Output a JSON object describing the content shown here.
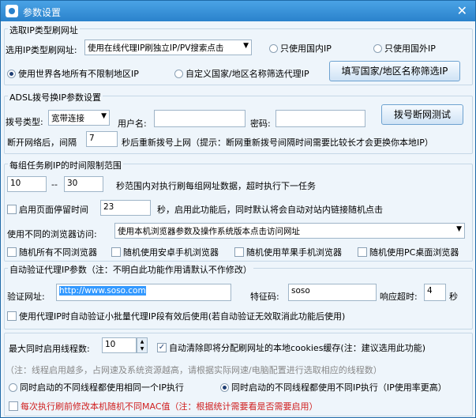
{
  "window": {
    "title": "参数设置",
    "close_glyph": "✕"
  },
  "ip_type": {
    "group_title": "选取IP类型刷网址",
    "select_label": "选用IP类型刷网址:",
    "select_value": "使用在线代理IP刷独立IP/PV搜索点击",
    "radio_domestic": "只使用国内IP",
    "radio_foreign": "只使用国外IP",
    "radio_all": "使用世界各地所有不限制地区IP",
    "radio_custom": "自定义国家/地区名称筛选代理IP",
    "fill_button": "填写国家/地区名称筛选IP"
  },
  "adsl": {
    "group_title": "ADSL拨号换IP参数设置",
    "dial_type_label": "拨号类型:",
    "dial_type_value": "宽带连接",
    "username_label": "用户名:",
    "username_value": "",
    "password_label": "密码:",
    "password_value": "",
    "test_button": "拨号断网测试",
    "interval_prefix": "断开网络后，间隔",
    "interval_value": "7",
    "interval_suffix": "秒后重新拨号上网（提示：断网重新拨号间隔时间需要比较长才会更换你本地IP）"
  },
  "time_limit": {
    "group_title": "每组任务刷IP的时间限制范围",
    "min_value": "10",
    "sep": "--",
    "max_value": "30",
    "range_desc": "秒范围内对执行刷每组网址数据，超时执行下一任务",
    "stay_check": "启用页面停留时间",
    "stay_value": "23",
    "stay_desc": "秒，启用此功能后，同时默认将会自动对站内链接随机点击",
    "browser_label": "使用不同的浏览器访问:",
    "browser_value": "使用本机浏览器参数及操作系统版本点击访问网址",
    "rand_all": "随机所有不同浏览器",
    "rand_android": "随机使用安卓手机浏览器",
    "rand_apple": "随机使用苹果手机浏览器",
    "rand_pc": "随机使用PC桌面浏览器"
  },
  "verify": {
    "group_title": "自动验证代理IP参数（注：不明白此功能作用请默认不作修改）",
    "url_label": "验证网址:",
    "url_value": "http://www.soso.com",
    "code_label": "特征码:",
    "code_value": "soso",
    "timeout_label": "响应超时:",
    "timeout_value": "4",
    "timeout_unit": "秒",
    "batch_check": "使用代理IP时自动验证小批量代理IP段有效后使用(若自动验证无效取消此功能后使用)"
  },
  "threads": {
    "max_label": "最大同时启用线程数:",
    "max_value": "10",
    "auto_clear_check": "自动清除即将分配刷网址的本地cookies缓存(注：建议选用此功能)",
    "note": "（注：线程启用越多，占网速及系统资源越高，请根据实际网速/电脑配置进行选取相应的线程数）",
    "radio_same_ip": "同时启动的不同线程都使用相同一个IP执行",
    "radio_diff_ip": "同时启动的不同线程都使用不同IP执行（IP使用率更高）",
    "mac_check": "每次执行刷前修改本机随机不同MAC值（注：根据统计需要看是否需要启用）"
  }
}
